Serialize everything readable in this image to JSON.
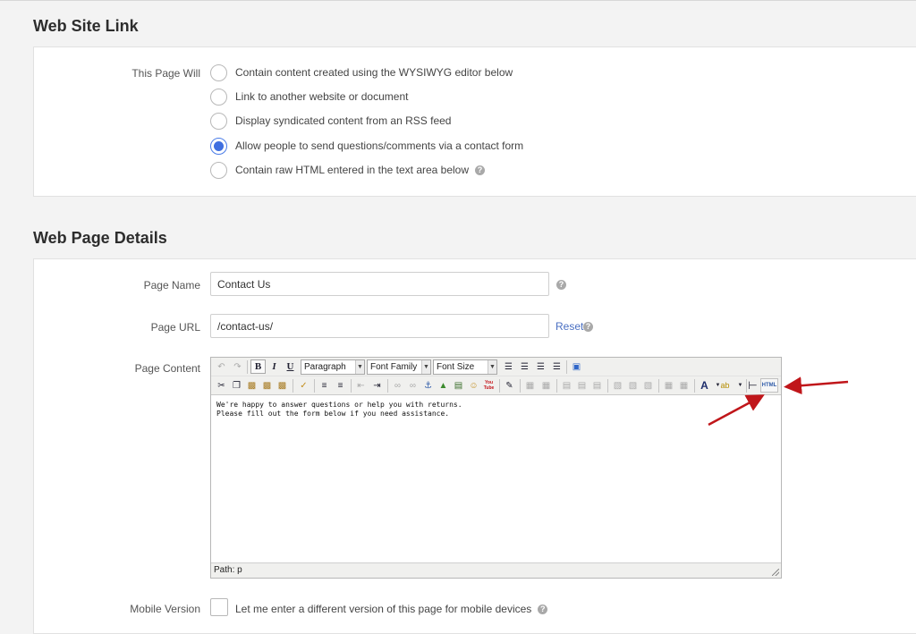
{
  "website_link": {
    "title": "Web Site Link",
    "page_will_label": "This Page Will",
    "options": [
      {
        "label": "Contain content created using the WYSIWYG editor below",
        "checked": false
      },
      {
        "label": "Link to another website or document",
        "checked": false
      },
      {
        "label": "Display syndicated content from an RSS feed",
        "checked": false
      },
      {
        "label": "Allow people to send questions/comments via a contact form",
        "checked": true
      },
      {
        "label": "Contain raw HTML entered in the text area below",
        "checked": false
      }
    ]
  },
  "details": {
    "title": "Web Page Details",
    "page_name_label": "Page Name",
    "page_name_value": "Contact Us",
    "page_url_label": "Page URL",
    "page_url_value": "/contact-us/",
    "reset_label": "Reset",
    "page_content_label": "Page Content",
    "mobile_label": "Mobile Version",
    "mobile_checkbox_label": "Let me enter a different version of this page for mobile devices",
    "help_glyph": "?"
  },
  "editor": {
    "format_select": "Paragraph",
    "font_family_select": "Font Family",
    "font_size_select": "Font Size",
    "bold_glyph": "B",
    "italic_glyph": "I",
    "underline_glyph": "U",
    "html_button_label": "HTML",
    "youtube_label": "You\nTube",
    "content_lines": [
      "We're happy to answer questions or help you with returns.",
      "Please fill out the form below if you need assistance."
    ],
    "path_label": "Path: p"
  },
  "colors": {
    "accent_blue": "#3f6fe0",
    "link_blue": "#4a6fc2",
    "arrow_red": "#c0161a"
  }
}
